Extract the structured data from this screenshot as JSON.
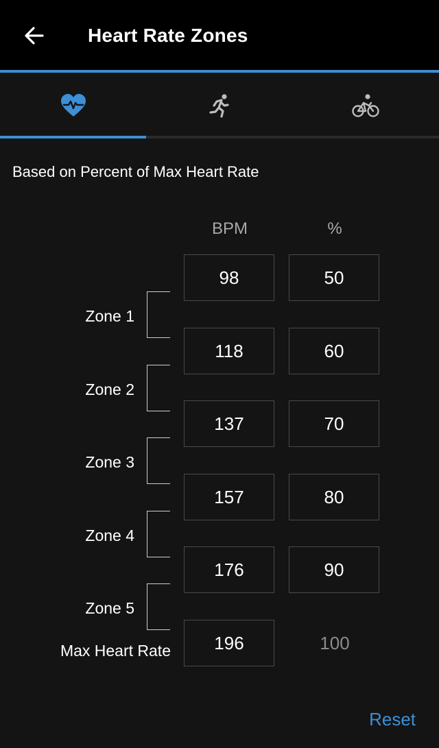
{
  "header": {
    "title": "Heart Rate Zones",
    "back_icon": "arrow-left-icon"
  },
  "tabs": [
    {
      "icon": "heart-icon",
      "active": true
    },
    {
      "icon": "running-icon",
      "active": false
    },
    {
      "icon": "cycling-icon",
      "active": false
    }
  ],
  "subtitle": "Based on Percent of Max Heart Rate",
  "columns": {
    "bpm": "BPM",
    "percent": "%"
  },
  "rows": [
    {
      "bpm": "98",
      "percent": "50"
    },
    {
      "bpm": "118",
      "percent": "60"
    },
    {
      "bpm": "137",
      "percent": "70"
    },
    {
      "bpm": "157",
      "percent": "80"
    },
    {
      "bpm": "176",
      "percent": "90"
    },
    {
      "bpm": "196",
      "percent": "100"
    }
  ],
  "zones": [
    "Zone 1",
    "Zone 2",
    "Zone 3",
    "Zone 4",
    "Zone 5"
  ],
  "max_label": "Max Heart Rate",
  "reset_label": "Reset",
  "colors": {
    "accent": "#3d8fd6",
    "background": "#141414",
    "header": "#000000"
  }
}
